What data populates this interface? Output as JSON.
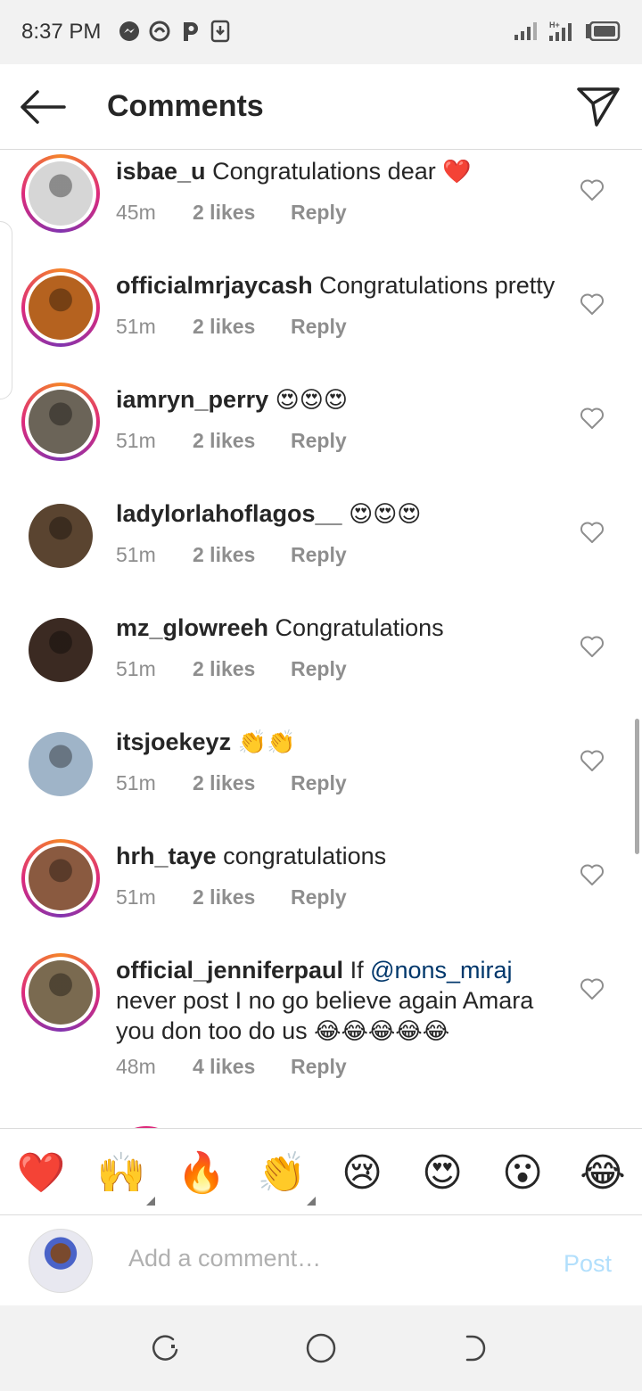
{
  "status_bar": {
    "time": "8:37 PM",
    "icons": [
      "messenger-icon",
      "hand-swirl-icon",
      "p-icon",
      "download-icon"
    ],
    "network_label": "H+"
  },
  "header": {
    "title": "Comments",
    "back_icon": "arrow-left-icon",
    "share_icon": "paper-plane-icon"
  },
  "comments": [
    {
      "user": "isbae_u",
      "text": " Congratulations dear ",
      "emoji": "❤️",
      "time": "45m",
      "likes": "2 likes",
      "reply": "Reply",
      "story": true,
      "avatar_color": "#d6d6d6"
    },
    {
      "user": "officialmrjaycash",
      "text": " Congratulations pretty",
      "emoji": "",
      "time": "51m",
      "likes": "2 likes",
      "reply": "Reply",
      "story": true,
      "avatar_color": "#b5621f"
    },
    {
      "user": "iamryn_perry",
      "text": " ",
      "emoji": "😍😍😍",
      "time": "51m",
      "likes": "2 likes",
      "reply": "Reply",
      "story": true,
      "avatar_color": "#6b6458"
    },
    {
      "user": "ladylorlahoflagos__",
      "text": " ",
      "emoji": "😍😍😍",
      "time": "51m",
      "likes": "2 likes",
      "reply": "Reply",
      "story": false,
      "avatar_color": "#5a4430"
    },
    {
      "user": "mz_glowreeh",
      "text": " Congratulations",
      "emoji": "",
      "time": "51m",
      "likes": "2 likes",
      "reply": "Reply",
      "story": false,
      "avatar_color": "#3b2a22"
    },
    {
      "user": "itsjoekeyz",
      "text": " ",
      "emoji": "👏👏",
      "time": "51m",
      "likes": "2 likes",
      "reply": "Reply",
      "story": false,
      "avatar_color": "#9fb4c8"
    },
    {
      "user": "hrh_taye",
      "text": " congratulations",
      "emoji": "",
      "time": "51m",
      "likes": "2 likes",
      "reply": "Reply",
      "story": true,
      "avatar_color": "#8a5a40"
    },
    {
      "user": "official_jenniferpaul",
      "text_before": " If ",
      "mention": "@nons_miraj",
      "text_after": " never post I no go believe again Amara you don too do us ",
      "emoji": "😂😂😂😂😂",
      "time": "48m",
      "likes": "4 likes",
      "reply": "Reply",
      "story": true,
      "avatar_color": "#7a6a50"
    }
  ],
  "reactions": [
    {
      "emoji": "❤️",
      "name": "heart",
      "has_variants": false
    },
    {
      "emoji": "🙌",
      "name": "raised-hands",
      "has_variants": true
    },
    {
      "emoji": "🔥",
      "name": "fire",
      "has_variants": false
    },
    {
      "emoji": "👏",
      "name": "clapping-hands",
      "has_variants": true
    },
    {
      "emoji": "😢",
      "name": "crying-face",
      "has_variants": false
    },
    {
      "emoji": "😍",
      "name": "heart-eyes",
      "has_variants": false
    },
    {
      "emoji": "😮",
      "name": "surprised-face",
      "has_variants": false
    },
    {
      "emoji": "😂",
      "name": "tears-of-joy",
      "has_variants": false
    }
  ],
  "composer": {
    "placeholder": "Add a comment…",
    "post_label": "Post"
  },
  "nav_bar": {
    "icons": [
      "recent-apps-icon",
      "home-icon",
      "back-icon"
    ]
  }
}
